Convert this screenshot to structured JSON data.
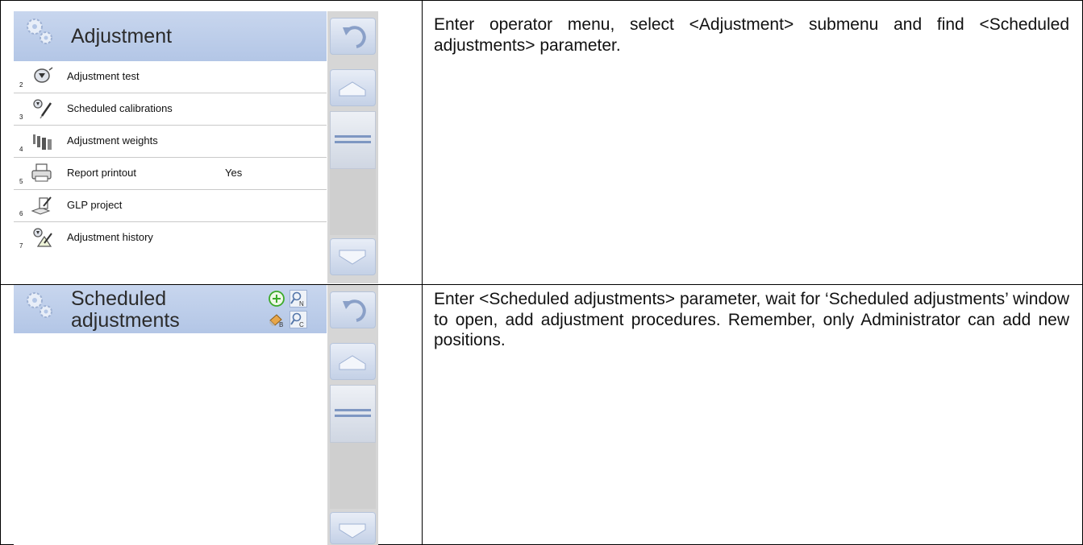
{
  "rows": [
    {
      "screen": {
        "title": "Adjustment",
        "menu_items": [
          {
            "number": "2",
            "label": "Adjustment test",
            "value": "",
            "icon": "adjustment-test-icon"
          },
          {
            "number": "3",
            "label": "Scheduled calibrations",
            "value": "",
            "icon": "scheduled-calibrations-icon"
          },
          {
            "number": "4",
            "label": "Adjustment weights",
            "value": "",
            "icon": "adjustment-weights-icon"
          },
          {
            "number": "5",
            "label": "Report printout",
            "value": "Yes",
            "icon": "printer-icon"
          },
          {
            "number": "6",
            "label": "GLP project",
            "value": "",
            "icon": "glp-project-icon"
          },
          {
            "number": "7",
            "label": "Adjustment history",
            "value": "",
            "icon": "adjustment-history-icon"
          }
        ]
      },
      "instruction": "Enter operator menu, select <Adjustment> submenu and find <Scheduled adjustments> parameter."
    },
    {
      "screen": {
        "title_line1": "Scheduled",
        "title_line2": "adjustments",
        "toolbar": [
          "add-icon",
          "search-n-icon",
          "delete-b-icon",
          "search-c-icon"
        ]
      },
      "instruction": "Enter <Scheduled adjustments> parameter, wait for ‘Scheduled adjustments’ window to open, add adjustment procedures. Remember, only Administrator can add new positions."
    }
  ],
  "colors": {
    "header": "#b8c9e8",
    "sidebar": "#d6d6d6",
    "accent": "#7e97c2"
  }
}
